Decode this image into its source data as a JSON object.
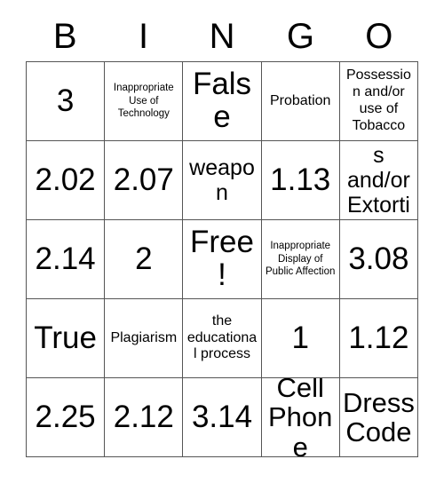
{
  "card": {
    "title_letters": [
      "B",
      "I",
      "N",
      "G",
      "O"
    ],
    "border_color": "#555555",
    "cell_background": "#ffffff",
    "text_color": "#000000",
    "free_space_label": "Free!",
    "rows": [
      [
        {
          "text": "3",
          "size": "sz-xl"
        },
        {
          "text": "Inappropriate Use of Technology",
          "size": "sz-xs"
        },
        {
          "text": "False",
          "size": "sz-xl"
        },
        {
          "text": "Probation",
          "size": "sz-sm"
        },
        {
          "text": "Possession and/or use of Tobacco",
          "size": "sz-sm"
        }
      ],
      [
        {
          "text": "2.02",
          "size": "sz-xl"
        },
        {
          "text": "2.07",
          "size": "sz-xl"
        },
        {
          "text": "weapon",
          "size": "sz-md"
        },
        {
          "text": "1.13",
          "size": "sz-xl"
        },
        {
          "text": "Threats and/or Extortion",
          "size": "sz-md"
        }
      ],
      [
        {
          "text": "2.14",
          "size": "sz-xl"
        },
        {
          "text": "2",
          "size": "sz-xl"
        },
        {
          "text": "Free!",
          "size": "sz-xl"
        },
        {
          "text": "Inappropriate Display of Public Affection",
          "size": "sz-xs"
        },
        {
          "text": "3.08",
          "size": "sz-xl"
        }
      ],
      [
        {
          "text": "True",
          "size": "sz-xl"
        },
        {
          "text": "Plagiarism",
          "size": "sz-sm"
        },
        {
          "text": "the educational process",
          "size": "sz-sm"
        },
        {
          "text": "1",
          "size": "sz-xl"
        },
        {
          "text": "1.12",
          "size": "sz-xl"
        }
      ],
      [
        {
          "text": "2.25",
          "size": "sz-xl"
        },
        {
          "text": "2.12",
          "size": "sz-xl"
        },
        {
          "text": "3.14",
          "size": "sz-xl"
        },
        {
          "text": "Cell Phone",
          "size": "sz-lg"
        },
        {
          "text": "Dress Code",
          "size": "sz-lg"
        }
      ]
    ]
  }
}
